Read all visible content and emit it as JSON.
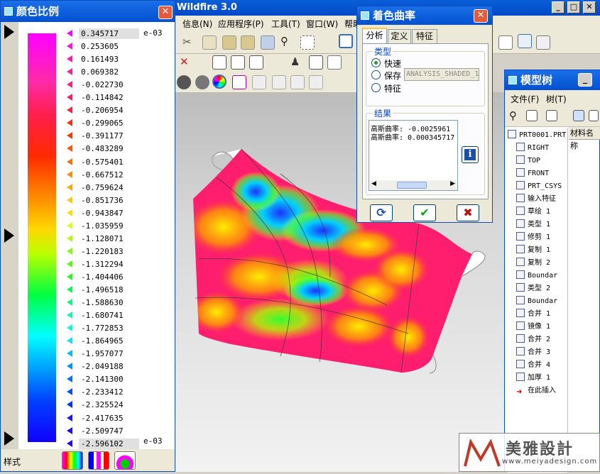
{
  "main_window": {
    "title": "Wildfire 3.0",
    "menu": [
      "信息(N)",
      "应用程序(P)",
      "工具(T)",
      "窗口(W)",
      "帮助"
    ]
  },
  "scale_panel": {
    "title": "颜色比例",
    "unit_top": "e-03",
    "unit_bottom": "e-03",
    "values": [
      "0.345717",
      "0.253605",
      "0.161493",
      "0.069382",
      "-0.022730",
      "-0.114842",
      "-0.206954",
      "-0.299065",
      "-0.391177",
      "-0.483289",
      "-0.575401",
      "-0.667512",
      "-0.759624",
      "-0.851736",
      "-0.943847",
      "-1.035959",
      "-1.128071",
      "-1.220183",
      "-1.312294",
      "-1.404406",
      "-1.496518",
      "-1.588630",
      "-1.680741",
      "-1.772853",
      "-1.864965",
      "-1.957077",
      "-2.049188",
      "-2.141300",
      "-2.233412",
      "-2.325524",
      "-2.417635",
      "-2.509747",
      "-2.596102"
    ],
    "tick_colors": [
      "#ff00ff",
      "#ff10e0",
      "#ff14c0",
      "#ff1aa0",
      "#ff1e80",
      "#ff2060",
      "#ff1e40",
      "#ff2a10",
      "#ff3a00",
      "#ff5800",
      "#ff7000",
      "#ff8c00",
      "#ffa800",
      "#ffc800",
      "#ffe000",
      "#e0ff00",
      "#b0ff00",
      "#80ff00",
      "#50ff00",
      "#20ff20",
      "#00ff50",
      "#00ff80",
      "#00ffb0",
      "#00ffe0",
      "#00e8ff",
      "#00c0ff",
      "#0098ff",
      "#0070ff",
      "#0050ff",
      "#0030ff",
      "#1818ff",
      "#2000ff",
      "#2000ff"
    ],
    "style_label": "样式"
  },
  "curvature_dialog": {
    "title": "着色曲率",
    "tabs": [
      "分析",
      "定义",
      "特征"
    ],
    "type_group_label": "类型",
    "options": [
      "快速",
      "保存",
      "特征"
    ],
    "selected_option": "快速",
    "save_name": "ANALYSIS_SHADED_1",
    "result_group_label": "结果",
    "result_lines": [
      "高斯曲率: -0.0025961",
      "高斯曲率: 0.000345717"
    ]
  },
  "model_tree": {
    "title": "模型树",
    "menu": [
      "文件(F)",
      "树(T)"
    ],
    "column_header": "材料名称",
    "items": [
      {
        "label": "PRT0001.PRT",
        "icon": "part-icon"
      },
      {
        "label": "RIGHT",
        "icon": "datum-plane-icon"
      },
      {
        "label": "TOP",
        "icon": "datum-plane-icon"
      },
      {
        "label": "FRONT",
        "icon": "datum-plane-icon"
      },
      {
        "label": "PRT_CSYS",
        "icon": "csys-icon"
      },
      {
        "label": "输入特征",
        "icon": "import-feature-icon"
      },
      {
        "label": "草绘 1",
        "icon": "sketch-icon"
      },
      {
        "label": "类型 1",
        "icon": "surface-icon"
      },
      {
        "label": "修剪 1",
        "icon": "trim-icon"
      },
      {
        "label": "复制 1",
        "icon": "copy-icon"
      },
      {
        "label": "复制 2",
        "icon": "copy-icon"
      },
      {
        "label": "Boundar",
        "icon": "boundary-blend-icon"
      },
      {
        "label": "类型 2",
        "icon": "surface-icon"
      },
      {
        "label": "Boundar",
        "icon": "boundary-blend-icon"
      },
      {
        "label": "合并 1",
        "icon": "merge-icon"
      },
      {
        "label": "镜像 1",
        "icon": "mirror-icon"
      },
      {
        "label": "合并 2",
        "icon": "merge-icon"
      },
      {
        "label": "合并 3",
        "icon": "merge-icon"
      },
      {
        "label": "合并 4",
        "icon": "merge-icon"
      },
      {
        "label": "加厚 1",
        "icon": "thicken-icon"
      },
      {
        "label": "在此插入",
        "icon": "insert-here-icon"
      }
    ]
  },
  "watermark": {
    "text": "美雅設計",
    "url": "www.meiyadesign.com"
  }
}
